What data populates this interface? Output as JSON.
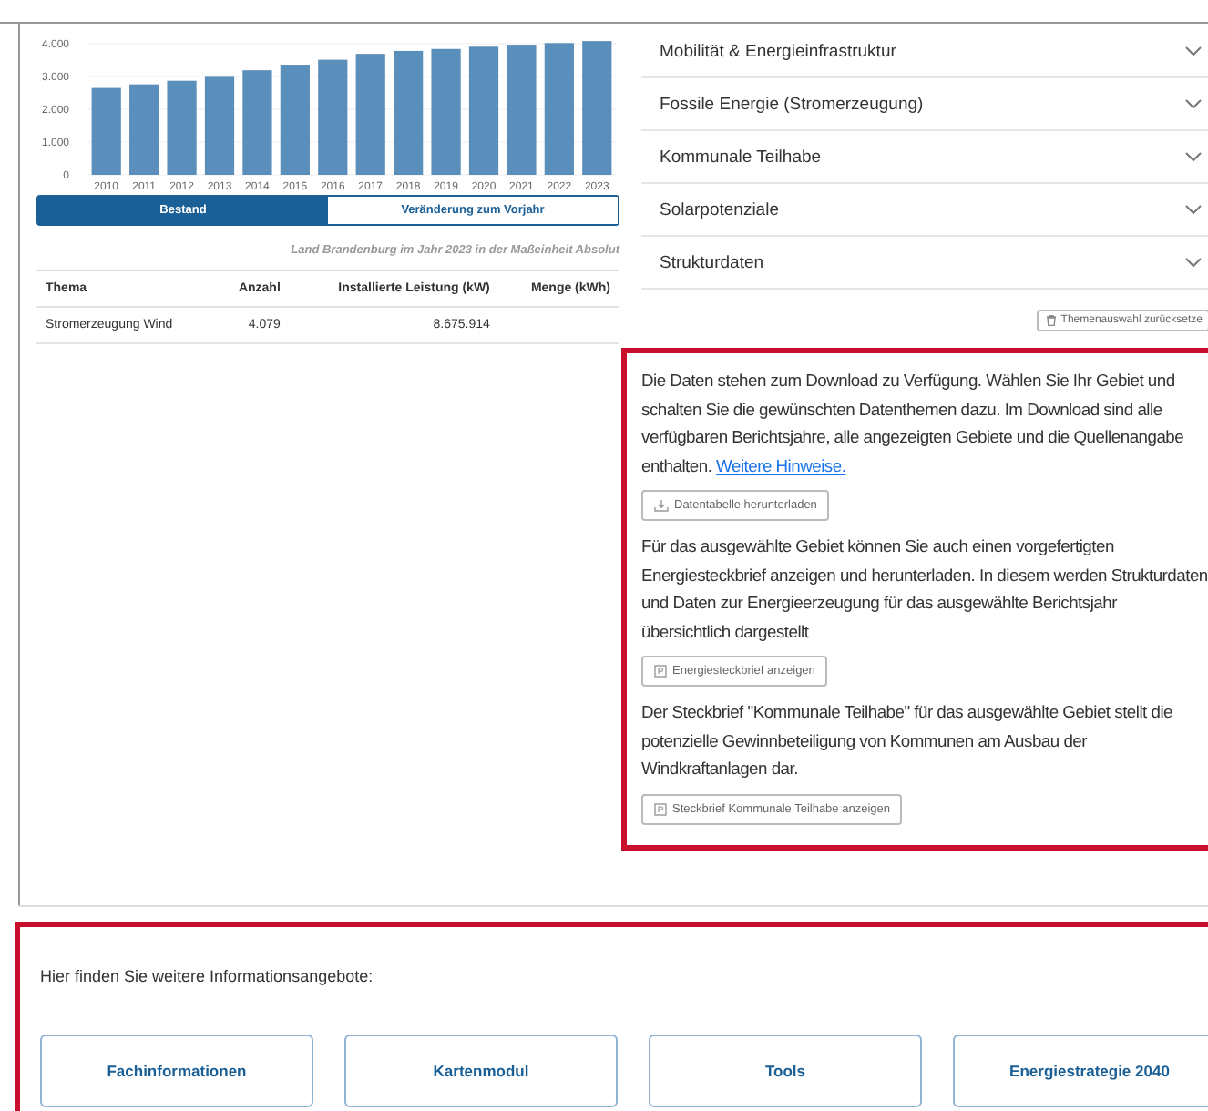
{
  "chart": {
    "chart_data": {
      "type": "bar",
      "categories": [
        "2010",
        "2011",
        "2012",
        "2013",
        "2014",
        "2015",
        "2016",
        "2017",
        "2018",
        "2019",
        "2020",
        "2021",
        "2022",
        "2023"
      ],
      "series": [
        {
          "color": "#5b8fbb",
          "values": [
            2650,
            2760,
            2870,
            2990,
            3190,
            3360,
            3510,
            3690,
            3780,
            3840,
            3910,
            3970,
            4020,
            4080
          ]
        }
      ],
      "ylim": [
        0,
        4200
      ],
      "grid": true,
      "yticks": [
        {
          "value": 0,
          "label": "0"
        },
        {
          "value": 1000,
          "label": "1.000"
        },
        {
          "value": 2000,
          "label": "2.000"
        },
        {
          "value": 3000,
          "label": "3.000"
        },
        {
          "value": 4000,
          "label": "4.000"
        }
      ]
    }
  },
  "view_toggle": [
    {
      "label": "Bestand",
      "selected": true
    },
    {
      "label": "Veränderung zum Vorjahr",
      "selected": false
    }
  ],
  "table": {
    "caption": "Land Brandenburg im Jahr 2023 in der Maßeinheit Absolut",
    "columns": [
      "Thema",
      "Anzahl",
      "Installierte Leistung (kW)",
      "Menge (kWh)"
    ],
    "rows": [
      {
        "cells": [
          "Stromerzeugung Wind",
          "4.079",
          "8.675.914"
        ]
      }
    ]
  },
  "accordion": [
    {
      "label": "Mobilität & Energieinfrastruktur",
      "expanded": false
    },
    {
      "label": "Fossile Energie (Stromerzeugung)",
      "expanded": false
    },
    {
      "label": "Kommunale Teilhabe",
      "expanded": false
    },
    {
      "label": "Solarpotenziale",
      "expanded": false
    },
    {
      "label": "Strukturdaten",
      "expanded": false
    }
  ],
  "reset_button": "Themenauswahl zurücksetze",
  "download_info": [
    {
      "text": "Die Daten stehen zum Download zu Verfügung. Wählen Sie Ihr Gebiet und schalten Sie die gewünschten Datenthemen dazu. Im Download sind alle verfügbaren Berichtsjahre, alle angezeigten Gebiete und die Quellenangabe enthalten.",
      "link": "Weitere Hinweise.",
      "button": "Datentabelle herunterladen",
      "kind": "download"
    },
    {
      "text": "Für das ausgewählte Gebiet können Sie auch einen vorgefertigten Energiesteckbrief anzeigen und herunterladen. In diesem werden Strukturdaten und Daten zur Energieerzeugung für das ausgewählte Berichtsjahr übersichtlich dargestellt",
      "button": "Energiesteckbrief anzeigen",
      "kind": "document"
    },
    {
      "text": "Der Steckbrief \"Kommunale Teilhabe\" für das ausgewählte Gebiet stellt die potenzielle Gewinnbeteiligung von Kommunen am Ausbau der Windkraftanlagen dar.",
      "button": "Steckbrief Kommunale Teilhabe anzeigen",
      "kind": "document"
    }
  ],
  "more_info": {
    "heading": "Hier finden Sie weitere Informationsangebote:",
    "links": [
      "Fachinformationen",
      "Kartenmodul",
      "Tools",
      "Energiestrategie 2040"
    ]
  }
}
